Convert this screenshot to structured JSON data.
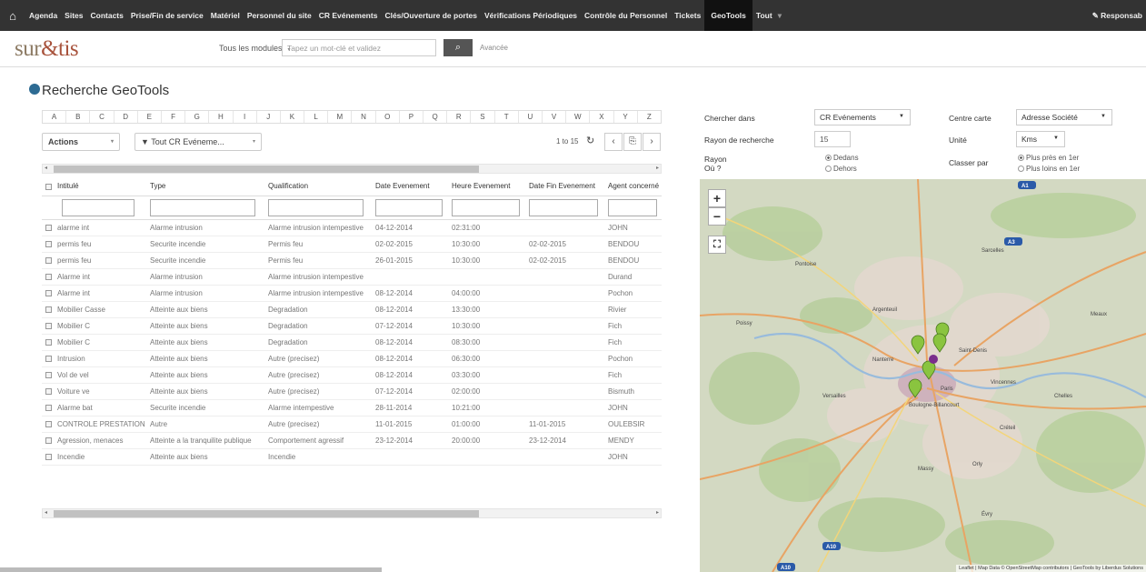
{
  "nav": {
    "items": [
      "Agenda",
      "Sites",
      "Contacts",
      "Prise/Fin de service",
      "Matériel",
      "Personnel du site",
      "CR Evénements",
      "Clés/Ouverture de portes",
      "Vérifications Périodiques",
      "Contrôle du Personnel",
      "Tickets",
      "GeoTools",
      "Tout"
    ],
    "active": "GeoTools",
    "tout_caret": "▾",
    "right": "Responsab"
  },
  "header": {
    "logo_a": "sur",
    "logo_b": "&tis",
    "modules_label": "Tous les modules",
    "keyword_placeholder": "Tapez un mot-clé et validez",
    "advanced": "Avancée"
  },
  "page": {
    "title": "Recherche GeoTools"
  },
  "letters": [
    "A",
    "B",
    "C",
    "D",
    "E",
    "F",
    "G",
    "H",
    "I",
    "J",
    "K",
    "L",
    "M",
    "N",
    "O",
    "P",
    "Q",
    "R",
    "S",
    "T",
    "U",
    "V",
    "W",
    "X",
    "Y",
    "Z"
  ],
  "toolbar": {
    "actions": "Actions",
    "filter": "Tout CR Evéneme...",
    "pagination": "1 to 15"
  },
  "table": {
    "columns": [
      "Intitulé",
      "Type",
      "Qualification",
      "Date Evenement",
      "Heure Evenement",
      "Date Fin Evenement",
      "Agent concerné"
    ],
    "rows": [
      [
        "alarme int",
        "Alarme intrusion",
        "Alarme intrusion intempestive",
        "04-12-2014",
        "02:31:00",
        "",
        "JOHN"
      ],
      [
        "permis feu",
        "Securite incendie",
        "Permis feu",
        "02-02-2015",
        "10:30:00",
        "02-02-2015",
        "BENDOU"
      ],
      [
        "permis feu",
        "Securite incendie",
        "Permis feu",
        "26-01-2015",
        "10:30:00",
        "02-02-2015",
        "BENDOU"
      ],
      [
        "Alarme int",
        "Alarme intrusion",
        "Alarme intrusion intempestive",
        "",
        "",
        "",
        "Durand"
      ],
      [
        "Alarme int",
        "Alarme intrusion",
        "Alarme intrusion intempestive",
        "08-12-2014",
        "04:00:00",
        "",
        "Pochon"
      ],
      [
        "Mobilier Casse",
        "Atteinte aux biens",
        "Degradation",
        "08-12-2014",
        "13:30:00",
        "",
        "Rivier"
      ],
      [
        "Mobilier C",
        "Atteinte aux biens",
        "Degradation",
        "07-12-2014",
        "10:30:00",
        "",
        "Fich"
      ],
      [
        "Mobilier C",
        "Atteinte aux biens",
        "Degradation",
        "08-12-2014",
        "08:30:00",
        "",
        "Fich"
      ],
      [
        "Intrusion",
        "Atteinte aux biens",
        "Autre (precisez)",
        "08-12-2014",
        "06:30:00",
        "",
        "Pochon"
      ],
      [
        "Vol de vel",
        "Atteinte aux biens",
        "Autre (precisez)",
        "08-12-2014",
        "03:30:00",
        "",
        "Fich"
      ],
      [
        "Voiture ve",
        "Atteinte aux biens",
        "Autre (precisez)",
        "07-12-2014",
        "02:00:00",
        "",
        "Bismuth"
      ],
      [
        "Alarme bat",
        "Securite incendie",
        "Alarme intempestive",
        "28-11-2014",
        "10:21:00",
        "",
        "JOHN"
      ],
      [
        "CONTROLE PRESTATION",
        "Autre",
        "Autre (precisez)",
        "11-01-2015",
        "01:00:00",
        "11-01-2015",
        "OULEBSIR"
      ],
      [
        "Agression, menaces",
        "Atteinte a la tranquilite publique",
        "Comportement agressif",
        "23-12-2014",
        "20:00:00",
        "23-12-2014",
        "MENDY"
      ],
      [
        "Incendie",
        "Atteinte aux biens",
        "Incendie",
        "",
        "",
        "",
        "JOHN"
      ]
    ]
  },
  "search": {
    "chercher_label": "Chercher dans",
    "chercher_value": "CR Evénements",
    "centre_label": "Centre carte",
    "centre_value": "Adresse Société",
    "rayon_recherche_label": "Rayon de recherche",
    "rayon_recherche_value": "15",
    "unite_label": "Unité",
    "unite_value": "Kms",
    "rayon_label": "Rayon",
    "ou_label": "Où ?",
    "dedans": "Dedans",
    "dehors": "Dehors",
    "classer_label": "Classer par",
    "plus_pres": "Plus près en 1er",
    "plus_loin": "Plus loins en 1er"
  },
  "map": {
    "zoom_in": "+",
    "zoom_out": "−",
    "fullscreen": "⛶",
    "attribution": "Leaflet | Map Data © OpenStreetMap contributors | GeoTools by Liberdus Solutions",
    "places": [
      "Pontoise",
      "Sarcelles",
      "Argenteuil",
      "Saint-Denis",
      "Paris",
      "Versailles",
      "Boulogne-Billancourt",
      "Vincennes",
      "Créteil",
      "Orly",
      "Massy",
      "Évry",
      "Chelles",
      "Meaux",
      "Poissy",
      "Nanterre"
    ],
    "road_labels": [
      "A1",
      "A3",
      "A10",
      "A10"
    ],
    "pin_color": "#8ac43f",
    "center_color": "#7a2d8c"
  }
}
